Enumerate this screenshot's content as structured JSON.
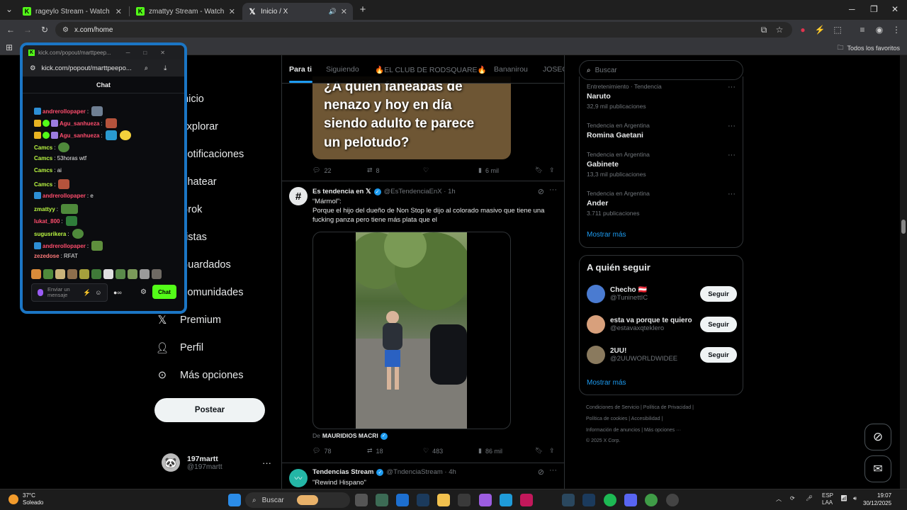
{
  "browser": {
    "tabs": [
      {
        "title": "rageylo Stream - Watch Live on",
        "fav": "K"
      },
      {
        "title": "zmattyy Stream - Watch Live on",
        "fav": "K"
      },
      {
        "title": "Inicio / X",
        "fav": "X",
        "active": true
      }
    ],
    "new_tab": "+",
    "url": "x.com/home",
    "bookmarks_label": "Todos los favoritos"
  },
  "x": {
    "nav": [
      {
        "label": "Inicio",
        "icon": "home-icon"
      },
      {
        "label": "Explorar",
        "icon": "search-icon"
      },
      {
        "label": "Notificaciones",
        "icon": "bell-icon"
      },
      {
        "label": "Chatear",
        "icon": "chat-icon"
      },
      {
        "label": "Grok",
        "icon": "grok-icon"
      },
      {
        "label": "Listas",
        "icon": "list-icon"
      },
      {
        "label": "Guardados",
        "icon": "bookmark-icon"
      },
      {
        "label": "Comunidades",
        "icon": "people-icon"
      },
      {
        "label": "Premium",
        "icon": "x-logo-icon"
      },
      {
        "label": "Perfil",
        "icon": "person-icon"
      },
      {
        "label": "Más opciones",
        "icon": "more-circle-icon"
      }
    ],
    "post_button": "Postear",
    "account": {
      "name": "197martt",
      "handle": "@197martt",
      "menu": "···"
    },
    "feed_tabs": [
      "Para ti",
      "Siguiendo",
      "🔥EL CLUB DE RODSQUARE🔥",
      "Bananirou",
      "JOSEC"
    ],
    "post1": {
      "media_text": [
        "¿A quién fanéabas de",
        "nenazo y hoy en día",
        "siendo adulto te parece",
        "un pelotudo?"
      ],
      "replies": "22",
      "reposts": "8",
      "likes": "",
      "views": "6 mil"
    },
    "post2": {
      "name": "Es tendencia en 𝕏",
      "handle": "@EsTendenciaEnX · 1h",
      "line1": "“Mármol”:",
      "line2": "Porque el hijo del dueño de Non Stop le dijo al colorado masivo que tiene una fucking panza pero tiene más plata que el",
      "credit_prefix": "De",
      "credit_name": "MAURIDIOS MACRI",
      "replies": "78",
      "reposts": "18",
      "likes": "483",
      "views": "86 mil"
    },
    "post3": {
      "name": "Tendencias Stream",
      "handle": "@TndenciaStream · 4h",
      "text": "\"Rewind Hispano\""
    },
    "search_placeholder": "Buscar",
    "trends": [
      {
        "category": "Entretenimiento · Tendencia",
        "name": "Naruto",
        "count": "32,9 mil publicaciones"
      },
      {
        "category": "Tendencia en Argentina",
        "name": "Romina Gaetani",
        "count": ""
      },
      {
        "category": "Tendencia en Argentina",
        "name": "Gabinete",
        "count": "13,3 mil publicaciones"
      },
      {
        "category": "Tendencia en Argentina",
        "name": "Ander",
        "count": "3.711 publicaciones"
      }
    ],
    "trends_more": "Mostrar más",
    "who_to_follow_title": "A quién seguir",
    "follow": [
      {
        "name": "Checho 🇦🇹",
        "handle": "@TuninettIC",
        "button": "Seguir"
      },
      {
        "name": "esta va porque te quiero",
        "handle": "@estavaxqteklero",
        "button": "Seguir"
      },
      {
        "name": "2UU!",
        "handle": "@2UUWORLDWIDEE",
        "button": "Seguir"
      }
    ],
    "follow_more": "Mostrar más",
    "footer": [
      "Condiciones de Servicio  |  Política de Privacidad  |",
      "Política de cookies  |  Accesibilidad  |",
      "Información de anuncios  |  Más opciones ···",
      "© 2025 X Corp."
    ]
  },
  "popup": {
    "window_title": "kick.com/popout/marttpeep...",
    "url": "kick.com/popout/marttpeepo...",
    "chat_title": "Chat",
    "messages": [
      {
        "user": "andrerollopaper",
        "text": ":",
        "color": "#ff4d6d"
      },
      {
        "user": "Agu_sanhueza",
        "text": ":",
        "color": "#ff4d6d"
      },
      {
        "user": "Agu_sanhueza",
        "text": ":",
        "color": "#ff4d6d"
      },
      {
        "user": "Camcs",
        "text": ":",
        "color": "#b9f542"
      },
      {
        "user": "Camcs",
        "text": ": 53horas wtf",
        "color": "#b9f542"
      },
      {
        "user": "Camcs",
        "text": ": ai",
        "color": "#b9f542"
      },
      {
        "user": "Camcs",
        "text": ":",
        "color": "#b9f542"
      },
      {
        "user": "andrerollopaper",
        "text": ": e",
        "color": "#ff4d6d"
      },
      {
        "user": "zmattyy",
        "text": ":",
        "color": "#b9f542"
      },
      {
        "user": "lukat_800",
        "text": ":",
        "color": "#ff4d6d"
      },
      {
        "user": "sugusrikera",
        "text": ":",
        "color": "#b9f542"
      },
      {
        "user": "andrerollopaper",
        "text": ":",
        "color": "#ff4d6d"
      },
      {
        "user": "zezedose",
        "text": ": RFAT",
        "color": "#ff7a7a"
      }
    ],
    "input_placeholder": "Enviar un mensaje",
    "send_button": "Chat"
  },
  "taskbar": {
    "weather_temp": "37°C",
    "weather_desc": "Soleado",
    "search": "Buscar",
    "lang1": "ESP",
    "lang2": "LAA",
    "time": "19:07",
    "date": "30/12/2025"
  },
  "colors": {
    "accent": "#1d9bf0",
    "kick_green": "#53fc18",
    "popup_border": "#1b76c5"
  }
}
